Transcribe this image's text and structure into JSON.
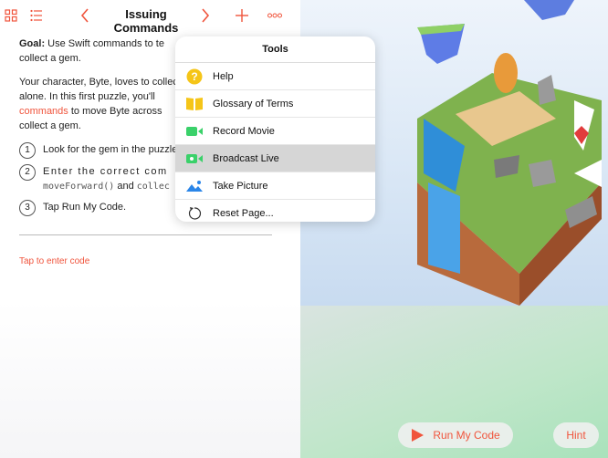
{
  "header": {
    "title": "Issuing Commands",
    "icons": [
      "grid-icon",
      "list-icon",
      "chevron-left-icon",
      "chevron-right-icon",
      "plus-icon",
      "more-icon"
    ]
  },
  "content": {
    "goal_label": "Goal:",
    "goal_text": " Use Swift commands to te",
    "goal_line2": "collect a gem.",
    "intro_1": "Your character, Byte, loves to collec",
    "intro_2": "alone. In this first puzzle, you'll",
    "intro_orange": "commands",
    "intro_3": " to move Byte across",
    "intro_4": "collect a gem.",
    "steps": [
      {
        "num": "1",
        "text": "Look for the gem in the puzzle"
      },
      {
        "num": "2",
        "text_a": "Enter the correct com",
        "code_a": "moveForward()",
        "and": " and ",
        "code_b": "collec"
      },
      {
        "num": "3",
        "text": "Tap Run My Code."
      }
    ],
    "tap_to_enter": "Tap to enter code"
  },
  "popover": {
    "title": "Tools",
    "items": [
      {
        "label": "Help",
        "icon": "question-icon"
      },
      {
        "label": "Glossary of Terms",
        "icon": "book-icon"
      },
      {
        "label": "Record Movie",
        "icon": "video-camera-icon"
      },
      {
        "label": "Broadcast Live",
        "icon": "broadcast-icon"
      },
      {
        "label": "Take Picture",
        "icon": "picture-icon"
      },
      {
        "label": "Reset Page...",
        "icon": "reset-icon"
      }
    ]
  },
  "controls": {
    "run_label": "Run My Code",
    "hint_label": "Hint"
  },
  "colors": {
    "accent": "#f0543c",
    "yellow": "#f5c518",
    "green": "#3ad16a",
    "blue": "#2b86e8"
  }
}
